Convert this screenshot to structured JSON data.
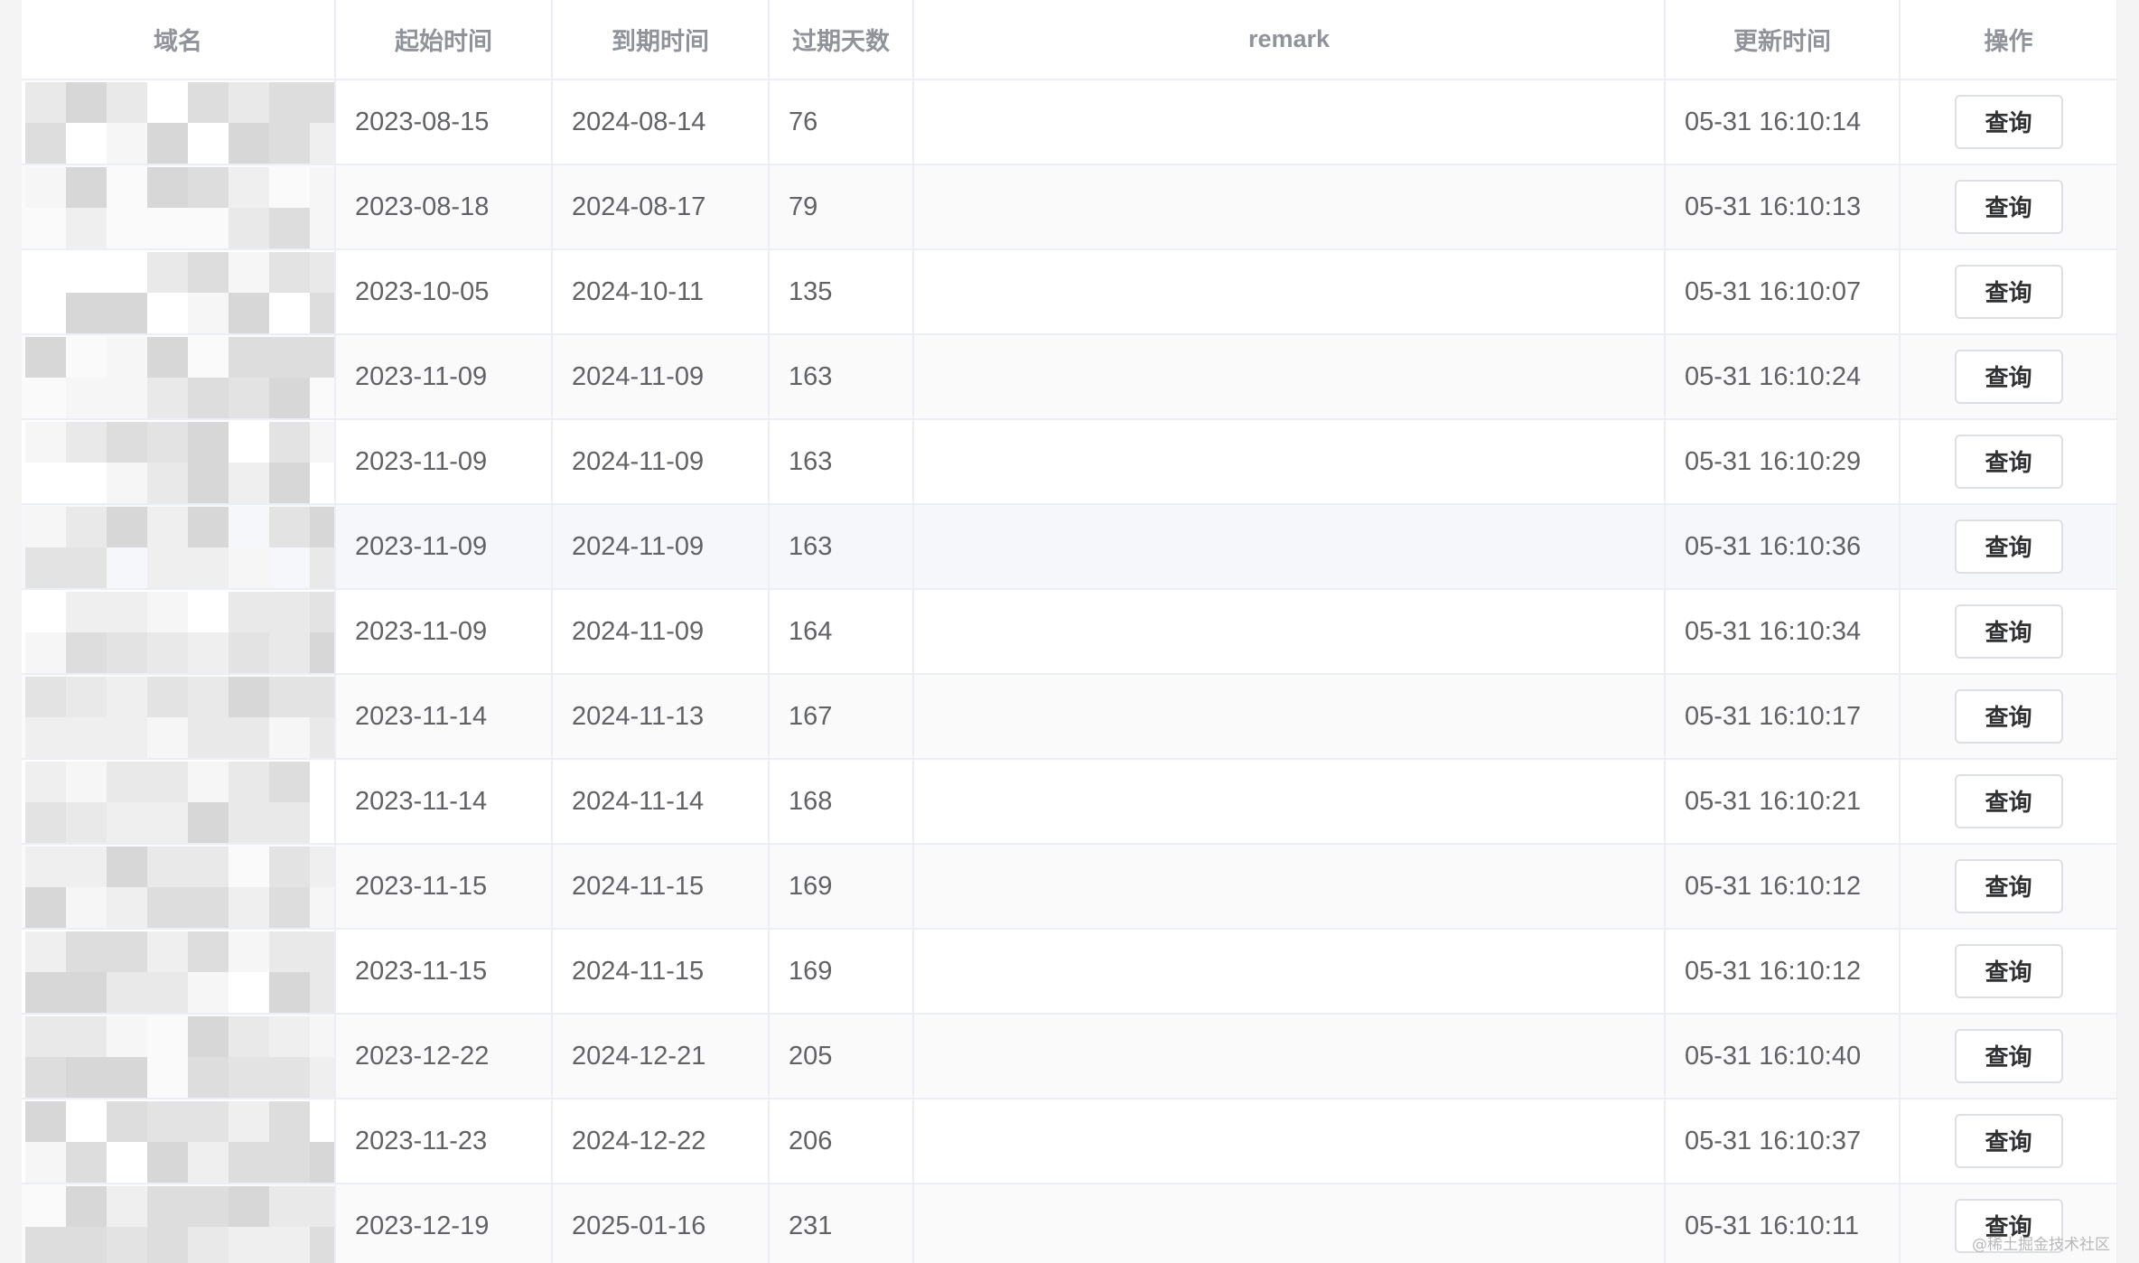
{
  "table": {
    "headers": {
      "domain": "域名",
      "start": "起始时间",
      "expire": "到期时间",
      "days": "过期天数",
      "remark": "remark",
      "updated": "更新时间",
      "action": "操作"
    },
    "action_label": "查询",
    "rows": [
      {
        "start": "2023-08-15",
        "expire": "2024-08-14",
        "days": "76",
        "remark": "",
        "updated": "05-31 16:10:14"
      },
      {
        "start": "2023-08-18",
        "expire": "2024-08-17",
        "days": "79",
        "remark": "",
        "updated": "05-31 16:10:13"
      },
      {
        "start": "2023-10-05",
        "expire": "2024-10-11",
        "days": "135",
        "remark": "",
        "updated": "05-31 16:10:07"
      },
      {
        "start": "2023-11-09",
        "expire": "2024-11-09",
        "days": "163",
        "remark": "",
        "updated": "05-31 16:10:24"
      },
      {
        "start": "2023-11-09",
        "expire": "2024-11-09",
        "days": "163",
        "remark": "",
        "updated": "05-31 16:10:29"
      },
      {
        "start": "2023-11-09",
        "expire": "2024-11-09",
        "days": "163",
        "remark": "",
        "updated": "05-31 16:10:36"
      },
      {
        "start": "2023-11-09",
        "expire": "2024-11-09",
        "days": "164",
        "remark": "",
        "updated": "05-31 16:10:34"
      },
      {
        "start": "2023-11-14",
        "expire": "2024-11-13",
        "days": "167",
        "remark": "",
        "updated": "05-31 16:10:17"
      },
      {
        "start": "2023-11-14",
        "expire": "2024-11-14",
        "days": "168",
        "remark": "",
        "updated": "05-31 16:10:21"
      },
      {
        "start": "2023-11-15",
        "expire": "2024-11-15",
        "days": "169",
        "remark": "",
        "updated": "05-31 16:10:12"
      },
      {
        "start": "2023-11-15",
        "expire": "2024-11-15",
        "days": "169",
        "remark": "",
        "updated": "05-31 16:10:12"
      },
      {
        "start": "2023-12-22",
        "expire": "2024-12-21",
        "days": "205",
        "remark": "",
        "updated": "05-31 16:10:40"
      },
      {
        "start": "2023-11-23",
        "expire": "2024-12-22",
        "days": "206",
        "remark": "",
        "updated": "05-31 16:10:37"
      },
      {
        "start": "2023-12-19",
        "expire": "2025-01-16",
        "days": "231",
        "remark": "",
        "updated": "05-31 16:10:11"
      }
    ]
  },
  "watermark": "@稀土掘金技术社区"
}
